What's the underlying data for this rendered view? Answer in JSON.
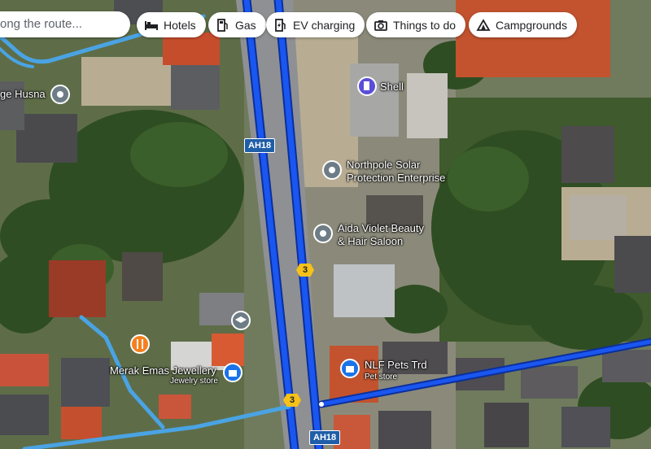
{
  "search": {
    "placeholder": "ong the route..."
  },
  "chips": [
    {
      "id": "hotels",
      "label": "Hotels",
      "icon": "bed-icon"
    },
    {
      "id": "gas",
      "label": "Gas",
      "icon": "gas-pump-icon"
    },
    {
      "id": "ev",
      "label": "EV charging",
      "icon": "ev-charger-icon"
    },
    {
      "id": "todo",
      "label": "Things to do",
      "icon": "camera-icon"
    },
    {
      "id": "camp",
      "label": "Campgrounds",
      "icon": "tent-icon"
    }
  ],
  "places": {
    "husna": "ge Husna",
    "shell": "Shell",
    "northpole_1": "Northpole Solar",
    "northpole_2": "Protection Enterprise",
    "aida_1": "Aida Violet Beauty",
    "aida_2": "& Hair Saloon",
    "merak": "Merak Emas Jewellery",
    "merak_type": "Jewelry store",
    "nlf": "NLF Pets Trd",
    "nlf_type": "Pet store"
  },
  "road_shields": {
    "ah18_top": "AH18",
    "ah18_bottom": "AH18",
    "route3_mid": "3",
    "route3_bottom": "3"
  },
  "colors": {
    "route": "#1a56f0",
    "route_outline": "#0b2f9c",
    "pin_gray": "#6e7c86",
    "pin_blue": "#1a73e8",
    "pin_purple": "#5b4ed8",
    "pin_orange": "#f4801f"
  }
}
